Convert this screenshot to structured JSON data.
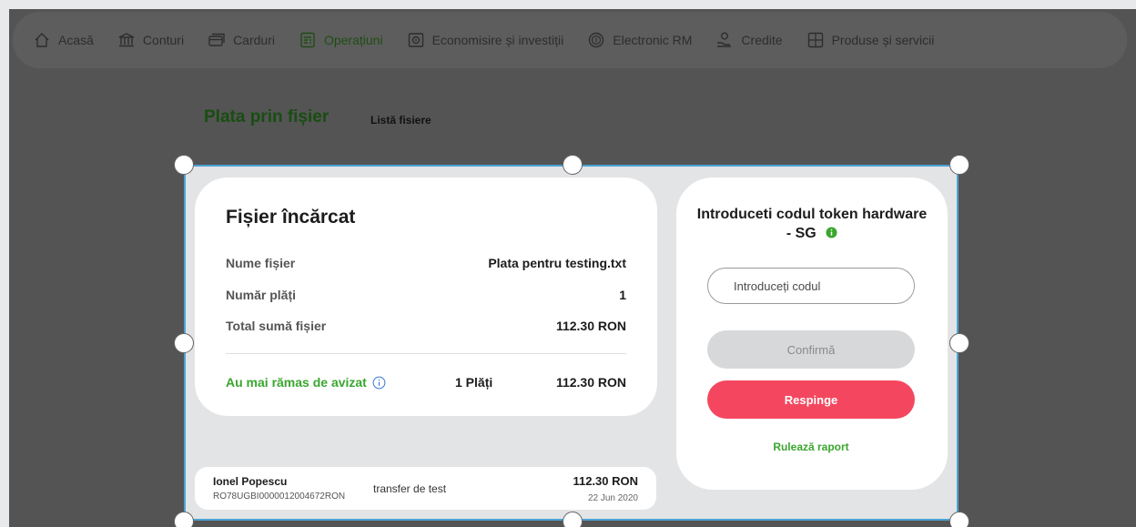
{
  "nav": {
    "items": [
      {
        "label": "Acasă",
        "icon": "home-icon",
        "active": false
      },
      {
        "label": "Conturi",
        "icon": "bank-icon",
        "active": false
      },
      {
        "label": "Carduri",
        "icon": "card-icon",
        "active": false
      },
      {
        "label": "Operațiuni",
        "icon": "operations-icon",
        "active": true
      },
      {
        "label": "Economisire și investiții",
        "icon": "safe-icon",
        "active": false
      },
      {
        "label": "Electronic RM",
        "icon": "coin-icon",
        "active": false
      },
      {
        "label": "Credite",
        "icon": "credit-icon",
        "active": false
      },
      {
        "label": "Produse și servicii",
        "icon": "products-icon",
        "active": false
      }
    ],
    "active_color": "#1f4d12"
  },
  "page": {
    "heading": "Plata prin fișier",
    "list_link": "Listă fisiere"
  },
  "file_card": {
    "title": "Fișier încărcat",
    "rows": [
      {
        "label": "Nume fișier",
        "value": "Plata pentru testing.txt"
      },
      {
        "label": "Număr plăți",
        "value": "1"
      },
      {
        "label": "Total sumă fișier",
        "value": "112.30 RON"
      }
    ],
    "remaining_label": "Au mai rămas de avizat",
    "remaining_count": "1 Plăți",
    "remaining_total": "112.30 RON"
  },
  "token_card": {
    "title": "Introduceti codul token hardware - SG",
    "input_placeholder": "Introduceți codul",
    "confirm_label": "Confirmă",
    "reject_label": "Respinge",
    "report_label": "Rulează raport"
  },
  "transaction": {
    "name": "Ionel Popescu",
    "iban": "RO78UGBI0000012004672RON",
    "description": "transfer de test",
    "amount": "112.30 RON",
    "date": "22 Jun 2020"
  },
  "colors": {
    "accent_green": "#3aa62f",
    "reject_red": "#f4475f",
    "selection_blue": "#4ba3d6"
  }
}
